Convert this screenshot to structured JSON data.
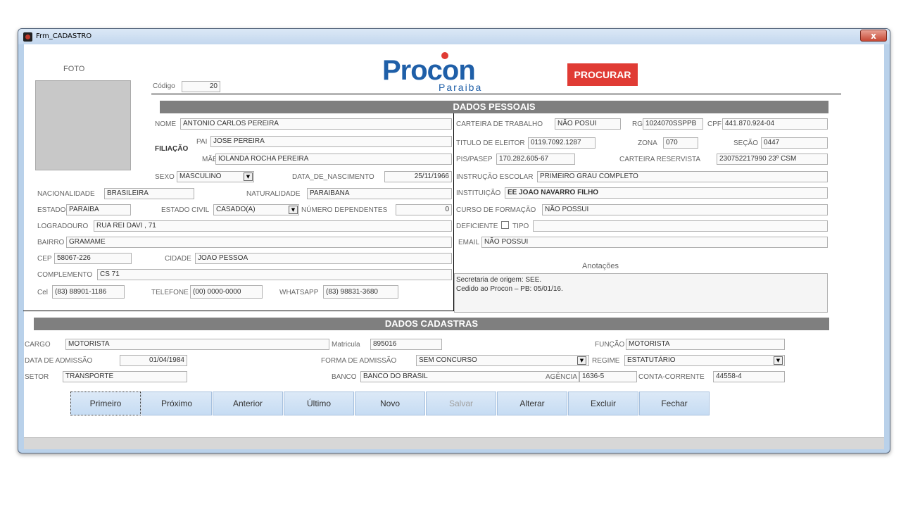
{
  "window": {
    "title": "Frm_CADASTRO",
    "close_glyph": "x"
  },
  "header": {
    "foto_label": "FOTO",
    "codigo_label": "Código",
    "codigo_value": "20",
    "logo_main": "Procon",
    "logo_sub": "Paraiba",
    "search_label": "PROCURAR"
  },
  "pessoais": {
    "title": "DADOS PESSOAIS",
    "nome_label": "NOME",
    "nome": "ANTONIO CARLOS PEREIRA",
    "filiacao_label": "FILIAÇÃO",
    "pai_label": "PAI",
    "pai": "JOSE PEREIRA",
    "mae_label": "MÃE",
    "mae": "IOLANDA ROCHA PEREIRA",
    "sexo_label": "SEXO",
    "sexo": "MASCULINO",
    "nasc_label": "DATA_DE_NASCIMENTO",
    "nasc": "25/11/1966",
    "nacionalidade_label": "NACIONALIDADE",
    "nacionalidade": "BRASILEIRA",
    "naturalidade_label": "NATURALIDADE",
    "naturalidade": "PARAIBANA",
    "estado_label": "ESTADO",
    "estado": "PARAIBA",
    "estado_civil_label": "ESTADO CIVIL",
    "estado_civil": "CASADO(A)",
    "dependentes_label": "NÚMERO DEPENDENTES",
    "dependentes": "0",
    "logradouro_label": "LOGRADOURO",
    "logradouro": "RUA REI DAVI , 71",
    "bairro_label": "BAIRRO",
    "bairro": "GRAMAME",
    "cep_label": "CEP",
    "cep": "58067-226",
    "cidade_label": "CIDADE",
    "cidade": "JOAO PESSOA",
    "complemento_label": "COMPLEMENTO",
    "complemento": "CS 71",
    "cel_label": "Cel",
    "cel": "(83) 88901-1186",
    "telefone_label": "TELEFONE",
    "telefone": "(00) 0000-0000",
    "whatsapp_label": "WHATSAPP",
    "whatsapp": "(83) 98831-3680",
    "carteira_label": "CARTEIRA DE TRABALHO",
    "carteira": "NÃO POSUI",
    "rg_label": "RG",
    "rg": "1024070SSPPB",
    "cpf_label": "CPF",
    "cpf": "441.870.924-04",
    "titulo_label": "TITULO DE ELEITOR",
    "titulo": "0119.7092.1287",
    "zona_label": "ZONA",
    "zona": "070",
    "secao_label": "SEÇÃO",
    "secao": "0447",
    "pis_label": "PIS/PASEP",
    "pis": "170.282.605-67",
    "reservista_label": "CARTEIRA RESERVISTA",
    "reservista": "230752217990 23º CSM",
    "instrucao_label": "INSTRUÇÃO ESCOLAR",
    "instrucao": "PRIMEIRO GRAU COMPLETO",
    "instituicao_label": "INSTITUIÇÃO",
    "instituicao": "EE JOAO NAVARRO FILHO",
    "curso_label": "CURSO DE FORMAÇÃO",
    "curso": "NÃO POSSUI",
    "deficiente_label": "DEFICIENTE",
    "tipo_label": "TIPO",
    "tipo": "",
    "email_label": "EMAIL",
    "email": "NÃO POSSUI",
    "anotacoes_label": "Anotações",
    "anotacoes_line1": "Secretaria de origem: SEE.",
    "anotacoes_line2": "Cedido ao Procon – PB: 05/01/16."
  },
  "cadastrais": {
    "title": "DADOS CADASTRAS",
    "cargo_label": "CARGO",
    "cargo": "MOTORISTA",
    "matricula_label": "Matricula",
    "matricula": "895016",
    "funcao_label": "FUNÇÃO",
    "funcao": "MOTORISTA",
    "admissao_label": "DATA DE ADMISSÃO",
    "admissao": "01/04/1984",
    "forma_label": "FORMA DE ADMISSÃO",
    "forma": "SEM CONCURSO",
    "regime_label": "REGIME",
    "regime": "ESTATUTÁRIO",
    "setor_label": "SETOR",
    "setor": "TRANSPORTE",
    "banco_label": "BANCO",
    "banco": "BANCO DO BRASIL",
    "agencia_label": "AGÊNCIA",
    "agencia": "1636-5",
    "conta_label": "CONTA-CORRENTE",
    "conta": "44558-4"
  },
  "buttons": {
    "primeiro": "Primeiro",
    "proximo": "Próximo",
    "anterior": "Anterior",
    "ultimo": "Último",
    "novo": "Novo",
    "salvar": "Salvar",
    "alterar": "Alterar",
    "excluir": "Excluir",
    "fechar": "Fechar"
  },
  "colors": {
    "accent_red": "#e03b34",
    "logo_blue": "#1f5fa8",
    "section_bar": "#7f7f7f"
  }
}
